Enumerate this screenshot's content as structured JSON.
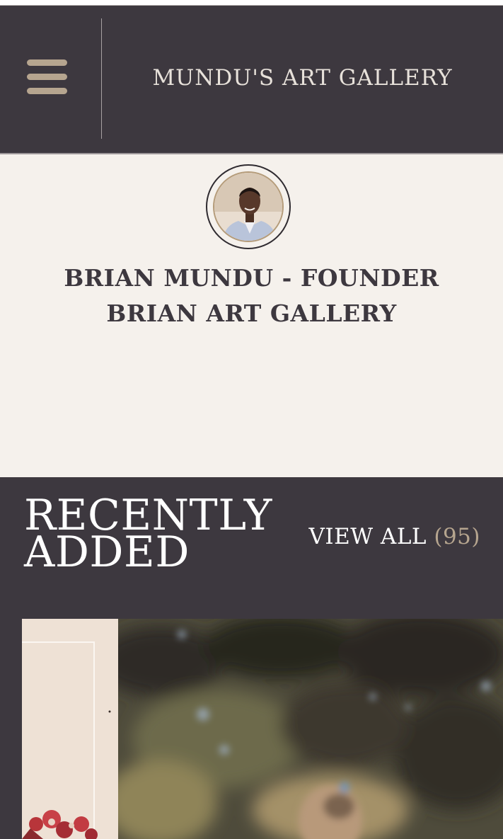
{
  "header": {
    "title": "MUNDU'S ART GALLERY",
    "menu_icon": "hamburger-menu-icon"
  },
  "profile": {
    "line1": "BRIAN MUNDU - FOUNDER",
    "line2": "BRIAN ART GALLERY",
    "avatar_icon": "founder-avatar"
  },
  "recent": {
    "title_line1": "RECENTLY",
    "title_line2": "ADDED",
    "view_all_label": "VIEW ALL",
    "view_all_count": "(95)"
  },
  "colors": {
    "header_bg": "#3d383f",
    "page_bg": "#f5f1ec",
    "accent": "#b6a58f"
  }
}
